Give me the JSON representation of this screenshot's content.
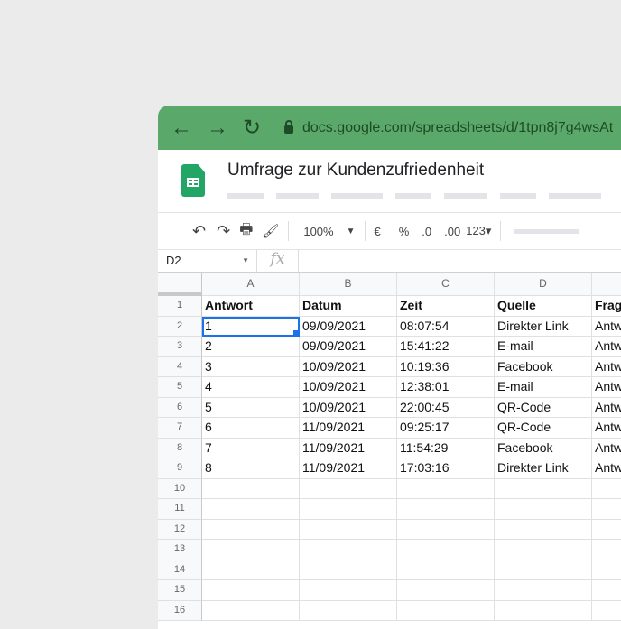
{
  "browser": {
    "url": "docs.google.com/spreadsheets/d/1tpn8j7g4wsAt",
    "back": "←",
    "forward": "→",
    "reload": "↻"
  },
  "doc": {
    "title": "Umfrage zur Kundenzufriedenheit"
  },
  "toolbar": {
    "undo": "↶",
    "redo": "↷",
    "print": "🖶",
    "paint": "🖌",
    "zoom": "100%",
    "currency": "€",
    "percent": "%",
    "dec_decrease": ".0",
    "dec_increase": ".00",
    "format": "123▾"
  },
  "formula": {
    "cell_ref": "D2",
    "fx": "fx",
    "value": ""
  },
  "columns": [
    "A",
    "B",
    "C",
    "D",
    ""
  ],
  "rows": [
    [
      "Antwort",
      "Datum",
      "Zeit",
      "Quelle",
      "Frag"
    ],
    [
      "1",
      "09/09/2021",
      "08:07:54",
      "Direkter Link",
      "Antw"
    ],
    [
      "2",
      "09/09/2021",
      "15:41:22",
      "E-mail",
      "Antw"
    ],
    [
      "3",
      "10/09/2021",
      "10:19:36",
      "Facebook",
      "Antw"
    ],
    [
      "4",
      "10/09/2021",
      "12:38:01",
      "E-mail",
      "Antw"
    ],
    [
      "5",
      "10/09/2021",
      "22:00:45",
      "QR-Code",
      "Antw"
    ],
    [
      "6",
      "11/09/2021",
      "09:25:17",
      "QR-Code",
      "Antw"
    ],
    [
      "7",
      "11/09/2021",
      "11:54:29",
      "Facebook",
      "Antw"
    ],
    [
      "8",
      "11/09/2021",
      "17:03:16",
      "Direkter Link",
      "Antw"
    ]
  ],
  "total_rows": 16,
  "colors": {
    "browser_bar": "#5aa86a",
    "sheets_green": "#23a566",
    "selection": "#1a73e8"
  }
}
